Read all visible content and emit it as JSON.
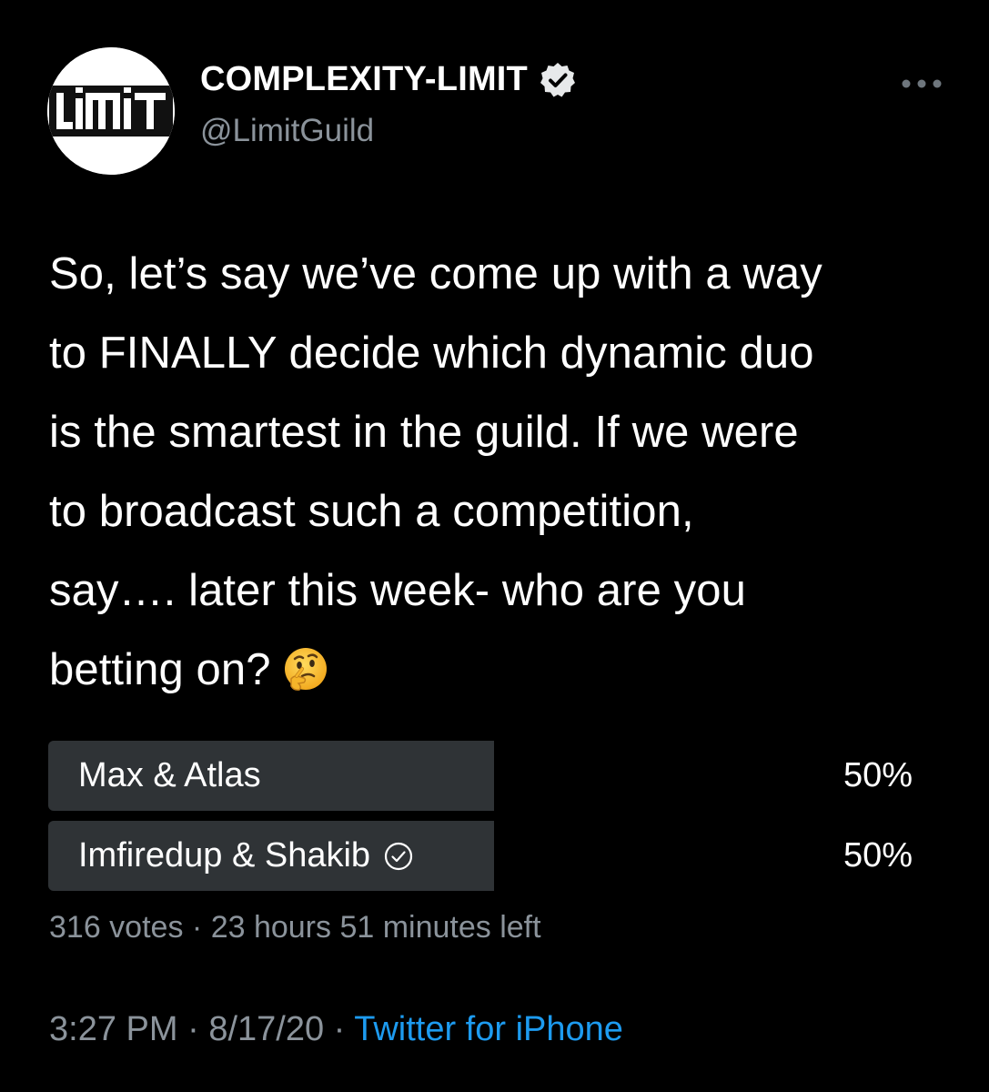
{
  "account": {
    "display_name": "COMPLEXITY-LIMIT",
    "handle": "@LimitGuild",
    "avatar_logo_text": "LiMiT",
    "verified": true
  },
  "tweet": {
    "text_lines": [
      "So, let’s say we’ve come up with a way",
      "to FINALLY decide which dynamic duo",
      "is the smartest in the guild. If we were",
      "to broadcast such a competition,",
      "say…. later this week- who are you",
      "betting on?"
    ],
    "emoji": "thinking-face-emoji"
  },
  "poll": {
    "options": [
      {
        "label": "Max & Atlas",
        "percent": "50%",
        "fraction": 0.5,
        "selected": false
      },
      {
        "label": "Imfiredup & Shakib",
        "percent": "50%",
        "fraction": 0.5,
        "selected": true
      }
    ],
    "votes": "316 votes",
    "separator": "·",
    "time_left": "23 hours 51 minutes left"
  },
  "meta": {
    "time": "3:27 PM",
    "date": "8/17/20",
    "separator": "·",
    "source": "Twitter for iPhone"
  },
  "colors": {
    "background": "#000000",
    "text": "#ffffff",
    "secondary_text": "#8b939b",
    "poll_bar": "#2f3336",
    "link": "#1d9bf0"
  },
  "icons": {
    "verified": "verified-badge-icon",
    "more": "more-horizontal-icon",
    "poll_check": "check-circle-icon"
  }
}
